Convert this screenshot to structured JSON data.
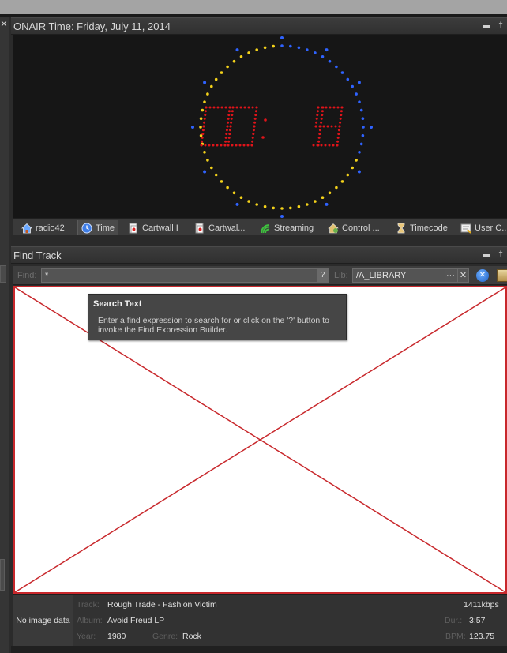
{
  "colors": {
    "clock_digits": "#e0141a",
    "ring_yellow": "#f4d21a",
    "ring_blue": "#2f63ff",
    "results_border": "#c8282c"
  },
  "onair_panel": {
    "title": "ONAIR Time: Friday, July 11, 2014",
    "header_icons": [
      "minimize-icon",
      "pin-icon"
    ],
    "clock": {
      "digits": "00:19",
      "seconds": 19
    }
  },
  "tabs": [
    {
      "label": "radio42",
      "icon": "home-icon",
      "active": false
    },
    {
      "label": "Time",
      "icon": "clock-icon",
      "active": true
    },
    {
      "label": "Cartwall I",
      "icon": "cart-icon",
      "active": false
    },
    {
      "label": "Cartwal...",
      "icon": "cart-icon",
      "active": false
    },
    {
      "label": "Streaming",
      "icon": "streaming-icon",
      "active": false
    },
    {
      "label": "Control ...",
      "icon": "control-icon",
      "active": false
    },
    {
      "label": "Timecode",
      "icon": "hourglass-icon",
      "active": false
    },
    {
      "label": "User C...",
      "icon": "user-command-icon",
      "active": false
    }
  ],
  "find_panel": {
    "title": "Find Track",
    "find_label": "Find:",
    "find_value": "*",
    "expression_button": "?",
    "lib_label": "Lib:",
    "lib_value": "/A_LIBRARY",
    "lib_browse": "···",
    "lib_remove": "✕"
  },
  "tooltip": {
    "title": "Search Text",
    "body": "Enter a find expression to search for or click on the '?' button to invoke the Find Expression Builder."
  },
  "track_info": {
    "no_image": "No image data",
    "track_label": "Track:",
    "track": "Rough Trade - Fashion Victim",
    "bitrate": "1411kbps",
    "album_label": "Album:",
    "album": "Avoid Freud LP",
    "duration_label": "Dur.:",
    "duration": "3:57",
    "year_label": "Year:",
    "year": "1980",
    "genre_label": "Genre:",
    "genre": "Rock",
    "bpm_label": "BPM:",
    "bpm": "123.75"
  }
}
